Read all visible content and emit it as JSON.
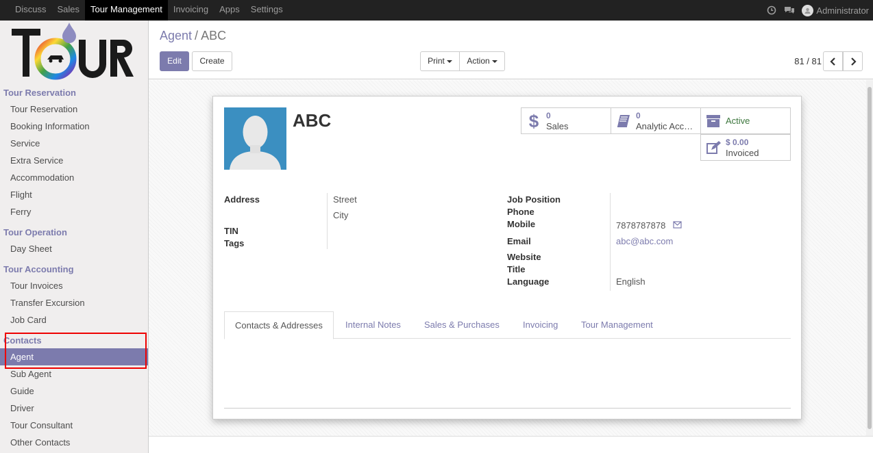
{
  "topbar": {
    "menu": [
      "Discuss",
      "Sales",
      "Tour Management",
      "Invoicing",
      "Apps",
      "Settings"
    ],
    "active": "Tour Management",
    "user": "Administrator"
  },
  "sidebar": {
    "sections": [
      {
        "title": "Tour Reservation",
        "items": [
          "Tour Reservation",
          "Booking Information",
          "Service",
          "Extra Service",
          "Accommodation",
          "Flight",
          "Ferry"
        ]
      },
      {
        "title": "Tour Operation",
        "items": [
          "Day Sheet"
        ]
      },
      {
        "title": "Tour Accounting",
        "items": [
          "Tour Invoices",
          "Transfer Excursion",
          "Job Card"
        ]
      },
      {
        "title": "Contacts",
        "items": [
          "Agent",
          "Sub Agent",
          "Guide",
          "Driver",
          "Tour Consultant",
          "Other Contacts"
        ]
      }
    ],
    "active_item": "Agent"
  },
  "control_panel": {
    "breadcrumb_parent": "Agent",
    "breadcrumb_sep": "/",
    "breadcrumb_current": "ABC",
    "edit": "Edit",
    "create": "Create",
    "print": "Print",
    "action": "Action",
    "pager": "81 / 81"
  },
  "record": {
    "name": "ABC",
    "smart_buttons": {
      "sales_value": "0",
      "sales_label": "Sales",
      "analytic_value": "0",
      "analytic_label": "Analytic Acc…",
      "active_label": "Active",
      "invoiced_value": "$ 0.00",
      "invoiced_label": "Invoiced"
    },
    "left_fields": {
      "address_label": "Address",
      "street": "Street",
      "city": "City",
      "tin_label": "TIN",
      "tags_label": "Tags"
    },
    "right_fields": {
      "job_position_label": "Job Position",
      "phone_label": "Phone",
      "mobile_label": "Mobile",
      "mobile": "7878787878",
      "email_label": "Email",
      "email": "abc@abc.com",
      "website_label": "Website",
      "title_label": "Title",
      "language_label": "Language",
      "language": "English"
    },
    "tabs": [
      "Contacts & Addresses",
      "Internal Notes",
      "Sales & Purchases",
      "Invoicing",
      "Tour Management"
    ],
    "active_tab": "Contacts & Addresses"
  },
  "colors": {
    "accent": "#7c7bad",
    "highlight": "#e00000",
    "active_status": "#3c763d"
  }
}
